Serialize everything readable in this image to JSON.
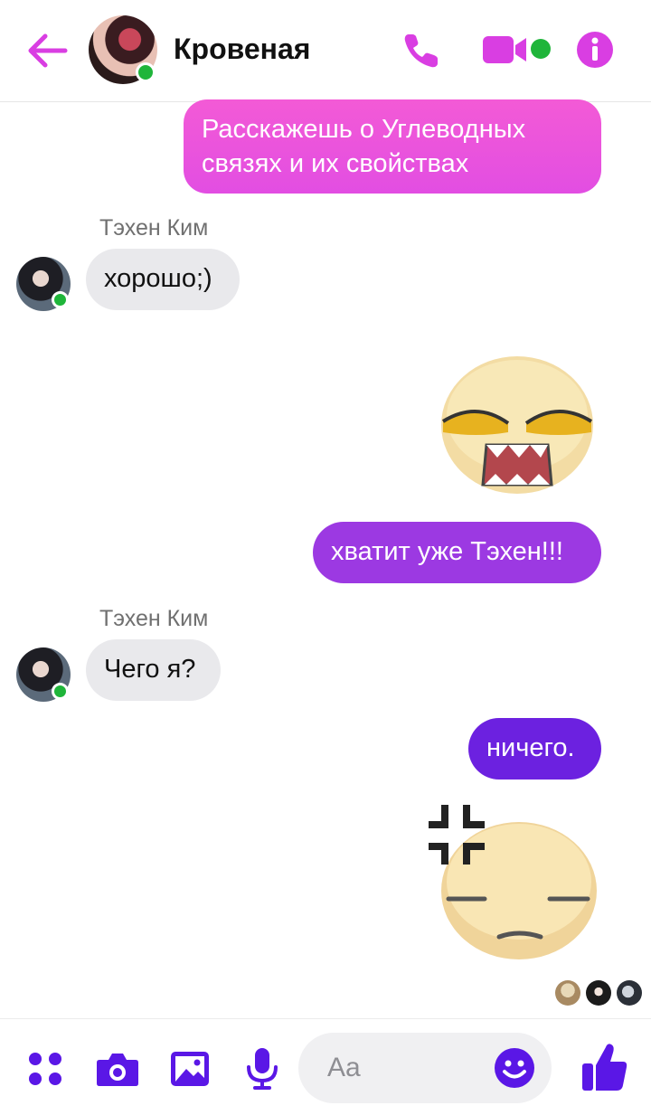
{
  "header": {
    "contact_name": "Кровеная",
    "icons": [
      "back-arrow-icon",
      "phone-icon",
      "video-icon",
      "info-icon"
    ],
    "accent_color": "#d93ee2",
    "online_color": "#1fb53a"
  },
  "messages": [
    {
      "from": "me",
      "type": "text",
      "text": "Расскажешь о Углеводных связях и их свойствах"
    },
    {
      "from": "Тэхен Ким",
      "type": "text",
      "text": "хорошо;)"
    },
    {
      "from": "me",
      "type": "sticker",
      "sticker": "smug-face-sticker"
    },
    {
      "from": "me",
      "type": "text",
      "text": "хватит уже Тэхен!!!"
    },
    {
      "from": "Тэхен Ким",
      "type": "text",
      "text": "Чего я?"
    },
    {
      "from": "me",
      "type": "text",
      "text": "ничего."
    },
    {
      "from": "me",
      "type": "sticker",
      "sticker": "annoyed-face-sticker"
    }
  ],
  "composer": {
    "placeholder": "Aa",
    "icons": [
      "apps-icon",
      "camera-icon",
      "gallery-icon",
      "mic-icon",
      "emoji-icon",
      "thumbs-up-icon"
    ],
    "accent_color": "#5a17e6"
  }
}
